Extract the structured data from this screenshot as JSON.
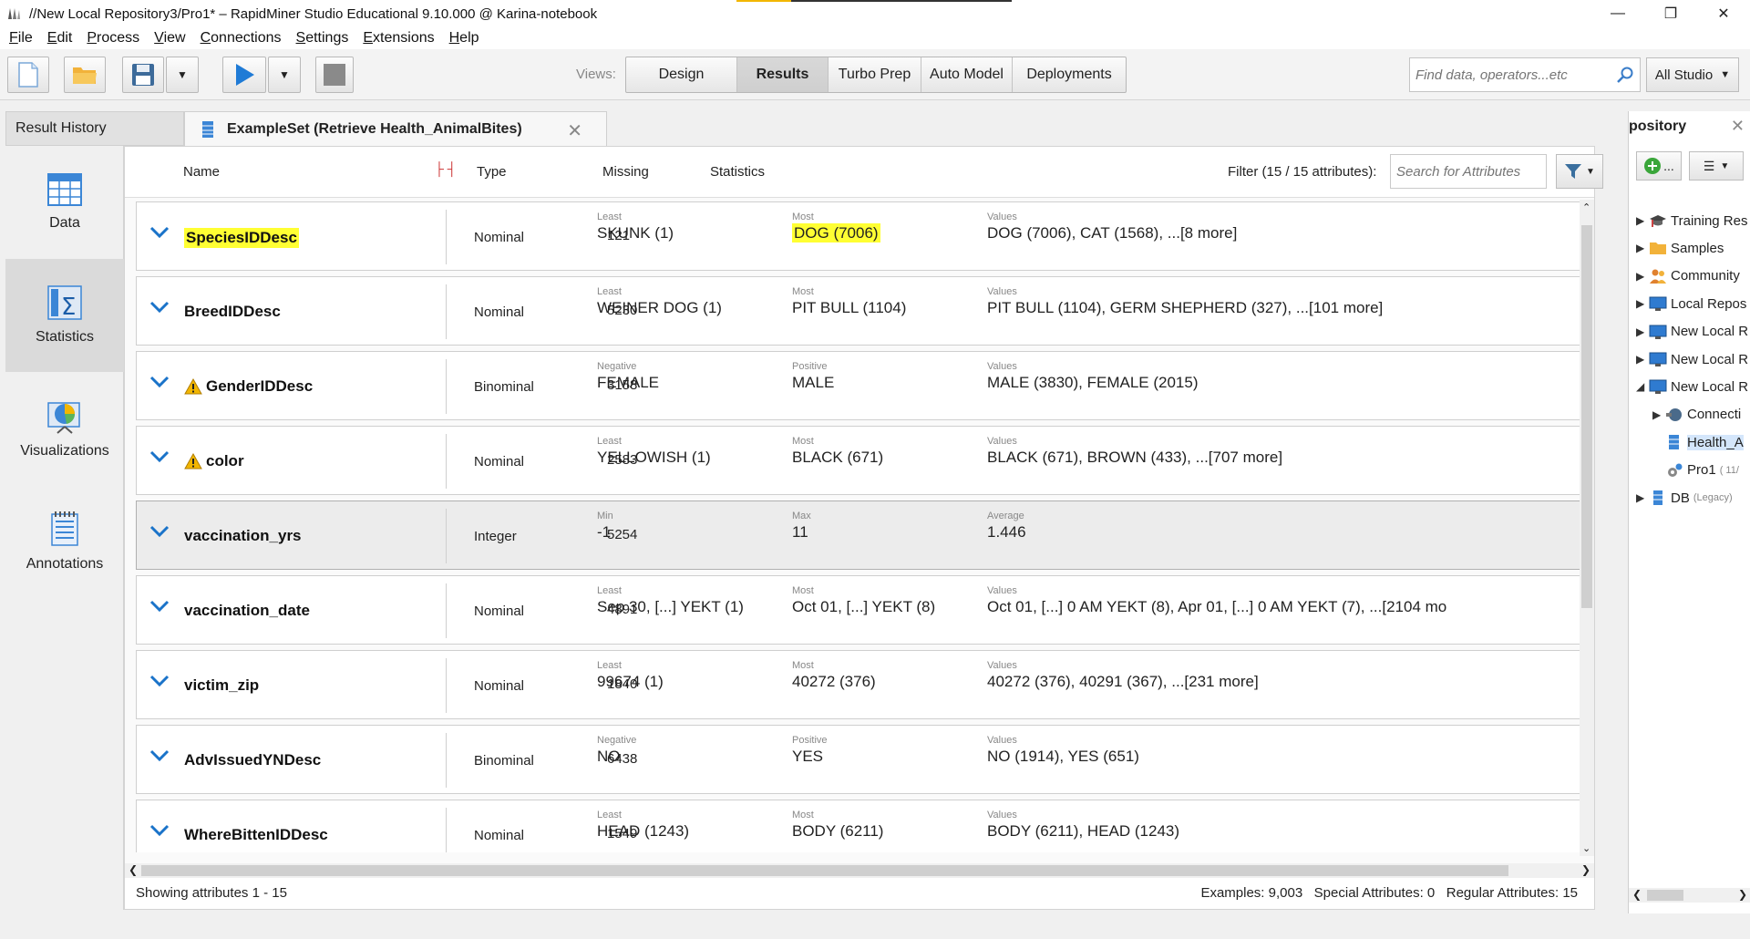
{
  "window": {
    "title": "//New Local Repository3/Pro1* – RapidMiner Studio Educational 9.10.000 @ Karina-notebook"
  },
  "menu": [
    {
      "label": "File",
      "mnemonic": "F",
      "rest": "ile"
    },
    {
      "label": "Edit",
      "mnemonic": "E",
      "rest": "dit"
    },
    {
      "label": "Process",
      "mnemonic": "P",
      "rest": "rocess"
    },
    {
      "label": "View",
      "mnemonic": "V",
      "rest": "iew"
    },
    {
      "label": "Connections",
      "mnemonic": "C",
      "rest": "onnections"
    },
    {
      "label": "Settings",
      "mnemonic": "S",
      "rest": "ettings"
    },
    {
      "label": "Extensions",
      "mnemonic": "E",
      "rest": "xtensions"
    },
    {
      "label": "Help",
      "mnemonic": "H",
      "rest": "elp"
    }
  ],
  "toolbar": {
    "views_label": "Views:",
    "views": [
      "Design",
      "Results",
      "Turbo Prep",
      "Auto Model",
      "Deployments"
    ],
    "active_view": "Results",
    "search_placeholder": "Find data, operators...etc",
    "scope": "All Studio"
  },
  "tabs": {
    "history": "Result History",
    "example": "ExampleSet (Retrieve Health_AnimalBites)"
  },
  "left_nav": [
    "Data",
    "Statistics",
    "Visualizations",
    "Annotations"
  ],
  "active_nav": "Statistics",
  "header": {
    "name": "Name",
    "type": "Type",
    "missing": "Missing",
    "statistics": "Statistics",
    "filter": "Filter (15 / 15 attributes):",
    "search_placeholder": "Search for Attributes"
  },
  "attributes": [
    {
      "name": "SpeciesIDDesc",
      "warn": false,
      "highlight": true,
      "type": "Nominal",
      "missing": "121",
      "s1_label": "Least",
      "s1": "SKUNK (1)",
      "s2_label": "Most",
      "s2": "DOG (7006)",
      "s3_label": "Values",
      "s3": "DOG (7006), CAT (1568), ...[8 more]"
    },
    {
      "name": "BreedIDDesc",
      "warn": false,
      "highlight": false,
      "type": "Nominal",
      "missing": "5230",
      "s1_label": "Least",
      "s1": "WEINER DOG (1)",
      "s2_label": "Most",
      "s2": "PIT BULL (1104)",
      "s3_label": "Values",
      "s3": "PIT BULL (1104), GERM SHEPHERD (327), ...[101 more]"
    },
    {
      "name": "GenderIDDesc",
      "warn": true,
      "highlight": false,
      "type": "Binominal",
      "missing": "3158",
      "s1_label": "Negative",
      "s1": "FEMALE",
      "s2_label": "Positive",
      "s2": "MALE",
      "s3_label": "Values",
      "s3": "MALE (3830), FEMALE (2015)"
    },
    {
      "name": "color",
      "warn": true,
      "highlight": false,
      "type": "Nominal",
      "missing": "2583",
      "s1_label": "Least",
      "s1": "YELLOWISH (1)",
      "s2_label": "Most",
      "s2": "BLACK (671)",
      "s3_label": "Values",
      "s3": "BLACK (671), BROWN (433), ...[707 more]"
    },
    {
      "name": "vaccination_yrs",
      "warn": false,
      "highlight": false,
      "type": "Integer",
      "missing": "5254",
      "s1_label": "Min",
      "s1": "-1",
      "s2_label": "Max",
      "s2": "11",
      "s3_label": "Average",
      "s3": "1.446",
      "selected": true
    },
    {
      "name": "vaccination_date",
      "warn": false,
      "highlight": false,
      "type": "Nominal",
      "missing": "4891",
      "s1_label": "Least",
      "s1": "Sep 30,  [...]  YEKT (1)",
      "s2_label": "Most",
      "s2": "Oct 01,  [...]  YEKT (8)",
      "s3_label": "Values",
      "s3": "Oct 01,  [...] 0 AM YEKT (8), Apr 01,  [...] 0 AM YEKT (7), ...[2104 mo"
    },
    {
      "name": "victim_zip",
      "warn": false,
      "highlight": false,
      "type": "Nominal",
      "missing": "1840",
      "s1_label": "Least",
      "s1": "99674 (1)",
      "s2_label": "Most",
      "s2": "40272 (376)",
      "s3_label": "Values",
      "s3": "40272 (376), 40291 (367), ...[231 more]"
    },
    {
      "name": "AdvIssuedYNDesc",
      "warn": false,
      "highlight": false,
      "type": "Binominal",
      "missing": "6438",
      "s1_label": "Negative",
      "s1": "NO",
      "s2_label": "Positive",
      "s2": "YES",
      "s3_label": "Values",
      "s3": "NO (1914), YES (651)"
    },
    {
      "name": "WhereBittenIDDesc",
      "warn": false,
      "highlight": false,
      "type": "Nominal",
      "missing": "1549",
      "s1_label": "Least",
      "s1": "HEAD (1243)",
      "s2_label": "Most",
      "s2": "BODY (6211)",
      "s3_label": "Values",
      "s3": "BODY (6211), HEAD (1243)"
    }
  ],
  "footer": {
    "left": "Showing attributes 1 - 15",
    "right": "Examples: 9,003   Special Attributes: 0   Regular Attributes: 15"
  },
  "repository": {
    "title": "pository",
    "add_label": "...",
    "items": [
      {
        "label": "Training Res",
        "icon": "graduation-cap-icon",
        "level": 0,
        "expanded": false
      },
      {
        "label": "Samples",
        "icon": "folder-icon",
        "level": 0,
        "expanded": false
      },
      {
        "label": "Community",
        "icon": "people-icon",
        "level": 0,
        "expanded": false
      },
      {
        "label": "Local Repos",
        "icon": "monitor-icon",
        "level": 0,
        "expanded": false
      },
      {
        "label": "New Local R",
        "icon": "monitor-icon",
        "level": 0,
        "expanded": false
      },
      {
        "label": "New Local R",
        "icon": "monitor-icon",
        "level": 0,
        "expanded": false
      },
      {
        "label": "New Local R",
        "icon": "monitor-icon",
        "level": 0,
        "expanded": true
      },
      {
        "label": "Connecti",
        "icon": "connection-icon",
        "level": 1,
        "expanded": false
      },
      {
        "label": "Health_A",
        "icon": "data-table-icon",
        "level": 1,
        "leaf": true,
        "selected": true
      },
      {
        "label": "Pro1",
        "icon": "process-gear-icon",
        "level": 1,
        "leaf": true,
        "suffix": "( 11/"
      },
      {
        "label": "DB",
        "icon": "database-icon",
        "level": 0,
        "expanded": false,
        "suffix": "(Legacy)"
      }
    ]
  },
  "colors": {
    "highlight": "#ffff33",
    "chevron": "#1a73c9",
    "warning": "#f2b600",
    "selection": "#d4e6fb"
  }
}
